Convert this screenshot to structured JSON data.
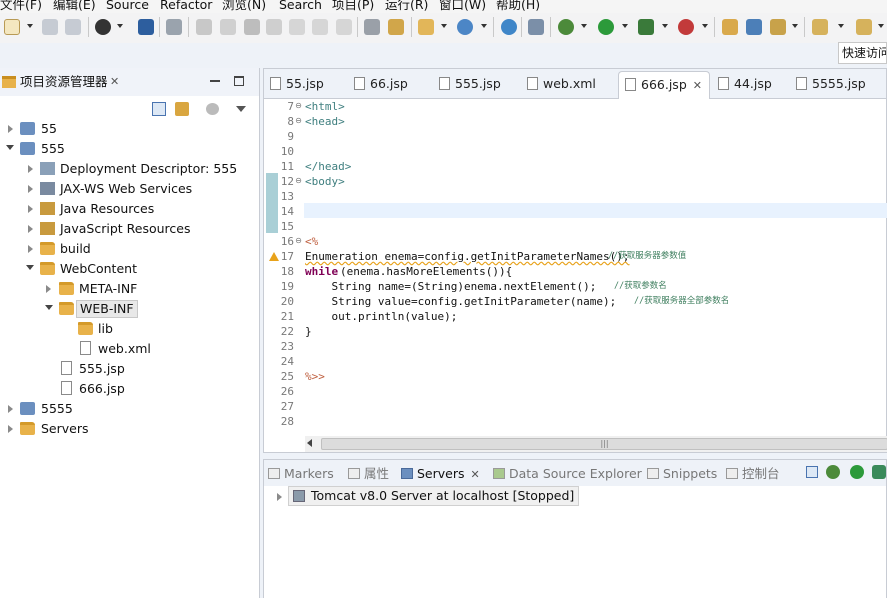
{
  "menu": [
    "文件(F)",
    "编辑(E)",
    "Source",
    "Refactor",
    "浏览(N)",
    "Search",
    "项目(P)",
    "运行(R)",
    "窗口(W)",
    "帮助(H)"
  ],
  "quick_access": "快速访问",
  "explorer": {
    "title": "项目资源管理器",
    "items": [
      "55",
      "555",
      "Deployment Descriptor: 555",
      "JAX-WS Web Services",
      "Java Resources",
      "JavaScript Resources",
      "build",
      "WebContent",
      "META-INF",
      "WEB-INF",
      "lib",
      "web.xml",
      "555.jsp",
      "666.jsp",
      "5555",
      "Servers"
    ]
  },
  "editor": {
    "tabs": [
      "55.jsp",
      "66.jsp",
      "555.jsp",
      "web.xml",
      "666.jsp",
      "44.jsp",
      "5555.jsp"
    ],
    "active_tab": "666.jsp",
    "line_numbers": [
      "7",
      "8",
      "9",
      "10",
      "11",
      "12",
      "13",
      "14",
      "15",
      "16",
      "17",
      "18",
      "19",
      "20",
      "21",
      "22",
      "23",
      "24",
      "25",
      "26",
      "27",
      "28"
    ],
    "lines": {
      "l7": "<html>",
      "l8": "<head>",
      "l11": "</head>",
      "l12": "<body>",
      "l16": "<%",
      "l17a": "Enumeration enema=config.getInitParameterNames();",
      "l17c": "//获取服务器参数值",
      "l18a": "while",
      "l18b": "(enema.hasMoreElements()){",
      "l19a": "    String name=(String)enema.nextElement();",
      "l19c": "//获取参数名",
      "l20a": "    String value=config.getInitParameter(name);",
      "l20c": "//获取服务器全部参数名",
      "l21": "    out.println(value);",
      "l22": "}",
      "l25": "%>>"
    },
    "scroll_thumb": "|||"
  },
  "bottom": {
    "tabs": [
      "Markers",
      "属性",
      "Servers",
      "Data Source Explorer",
      "Snippets",
      "控制台"
    ],
    "active_tab": "Servers",
    "server_entry": "Tomcat v8.0 Server at localhost  [Stopped]"
  },
  "colors": {
    "tag": "#3f7f7f",
    "keyword": "#7f0055",
    "comment": "#3f7f5f",
    "scriptlet": "#bf5f3f"
  }
}
